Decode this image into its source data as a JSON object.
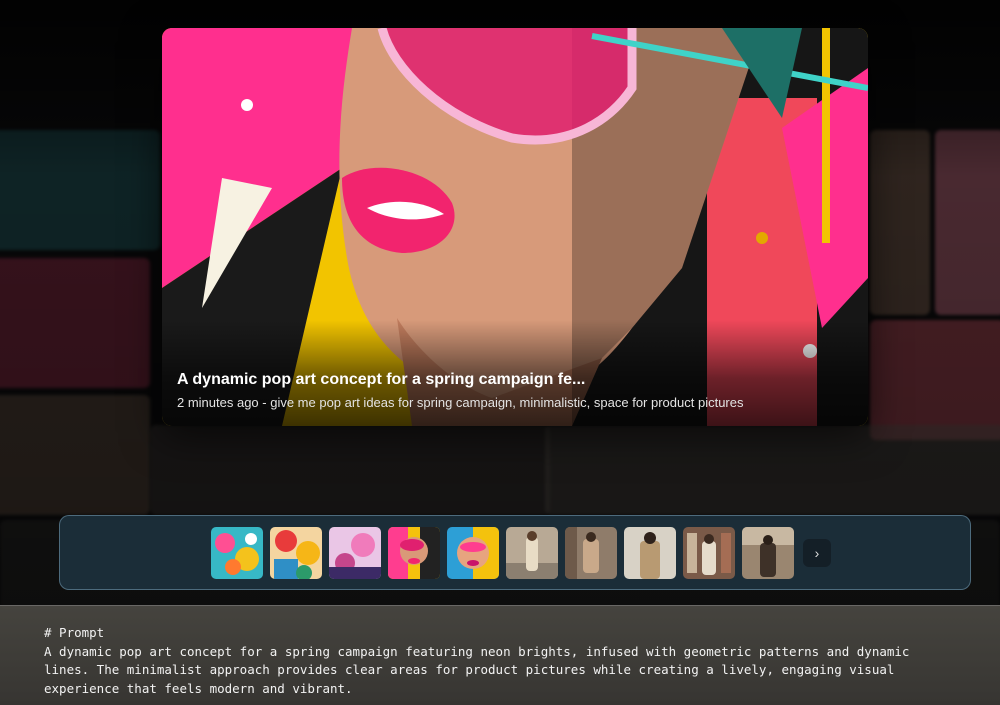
{
  "hero": {
    "title": "A dynamic pop art concept for a spring campaign fe...",
    "meta": "2 minutes ago - give me pop art ideas for spring campaign, minimalistic, space for product pictures"
  },
  "thumbnails": [
    {
      "name": "thumb-popart-flowers-1"
    },
    {
      "name": "thumb-popart-flowers-2"
    },
    {
      "name": "thumb-popart-flowers-3"
    },
    {
      "name": "thumb-popart-face-sunglasses"
    },
    {
      "name": "thumb-popart-face-colorful"
    },
    {
      "name": "thumb-fashion-street-1"
    },
    {
      "name": "thumb-fashion-street-2"
    },
    {
      "name": "thumb-fashion-street-3"
    },
    {
      "name": "thumb-fashion-store-1"
    },
    {
      "name": "thumb-fashion-store-2"
    }
  ],
  "next_icon": "chevron-right-icon",
  "next_glyph": "›",
  "prompt": {
    "heading": "# Prompt",
    "body": "A dynamic pop art concept for a spring campaign featuring neon brights, infused with geometric patterns and dynamic lines. The minimalist approach provides clear areas for product pictures while creating a lively, engaging visual experience that feels modern and vibrant."
  },
  "colors": {
    "strip_bg": "#1e3442",
    "strip_border": "#8cb9d2",
    "prompt_bg": "#504e48"
  }
}
